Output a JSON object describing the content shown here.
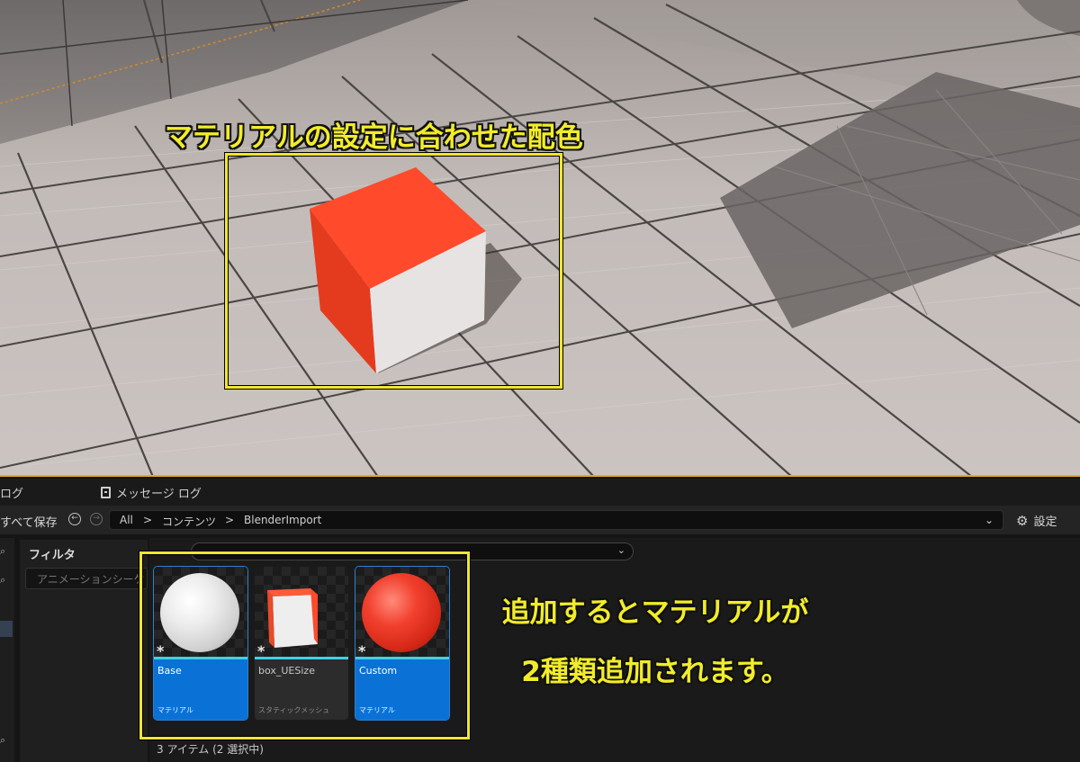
{
  "viewport": {
    "annotation_title": "マテリアルの設定に合わせた配色"
  },
  "tabs": {
    "output_log_label": "ログ",
    "message_log_label": "メッセージ ログ"
  },
  "toolbar": {
    "save_all_label": "すべて保存",
    "breadcrumbs": [
      "All",
      "コンテンツ",
      "BlenderImport"
    ],
    "separator": ">",
    "dropdown_icon": "chevron-down-icon",
    "settings_label": "設定",
    "settings_icon": "gear-icon"
  },
  "filter_panel": {
    "title": "フィルタ",
    "input_text": "アニメーションシーケ"
  },
  "assets": [
    {
      "name": "Base",
      "type": "マテリアル",
      "selected": true,
      "accent": "#0a72d6"
    },
    {
      "name": "box_UESize",
      "type": "スタティックメッシュ",
      "selected": false,
      "accent": "#3fd2e6"
    },
    {
      "name": "Custom",
      "type": "マテリアル",
      "selected": true,
      "accent": "#0a72d6"
    }
  ],
  "asset_marker": "*",
  "status": {
    "item_count": "3 アイテム (2 選択中)"
  },
  "annotation": {
    "line1": "追加するとマテリアルが",
    "line2": "2種類追加されます。"
  },
  "colors": {
    "highlight_box": "#f0e62e",
    "selection_blue": "#0a72d6",
    "viewport_border": "#e3a72a",
    "cube_red": "#ff4a2b"
  }
}
